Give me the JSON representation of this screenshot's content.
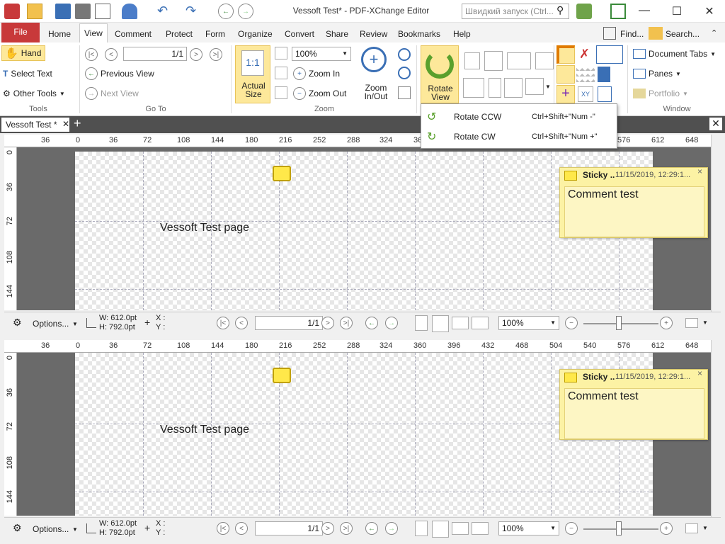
{
  "window": {
    "title": "Vessoft Test* - PDF-XChange Editor",
    "quick_launch_placeholder": "Швидкий запуск (Ctrl..."
  },
  "ribbon_tabs": [
    "File",
    "Home",
    "View",
    "Comment",
    "Protect",
    "Form",
    "Organize",
    "Convert",
    "Share",
    "Review",
    "Bookmarks",
    "Help"
  ],
  "ribbon_right": {
    "find": "Find...",
    "search": "Search..."
  },
  "tools": {
    "hand": "Hand",
    "select_text": "Select Text",
    "other_tools": "Other Tools",
    "label": "Tools"
  },
  "goto": {
    "page_value": "1/1",
    "previous_view": "Previous View",
    "next_view": "Next View",
    "label": "Go To"
  },
  "zoom": {
    "actual_size": "Actual\nSize",
    "actual_icon": "1:1",
    "zoom_value": "100%",
    "zoom_in": "Zoom In",
    "zoom_out": "Zoom Out",
    "zoom_inout": "Zoom\nIn/Out",
    "label": "Zoom"
  },
  "rotate": {
    "label": "Rotate\nView"
  },
  "window_grp": {
    "document_tabs": "Document Tabs",
    "panes": "Panes",
    "portfolio": "Portfolio",
    "label": "Window"
  },
  "dropdown": {
    "items": [
      {
        "label": "Rotate CCW",
        "shortcut": "Ctrl+Shift+\"Num -\""
      },
      {
        "label": "Rotate CW",
        "shortcut": "Ctrl+Shift+\"Num +\""
      }
    ]
  },
  "doc_tab": {
    "label": "Vessoft Test *"
  },
  "ruler": {
    "h_ticks": [
      "36",
      "0",
      "36",
      "72",
      "108",
      "144",
      "180",
      "216",
      "252",
      "288",
      "324",
      "360",
      "396",
      "432",
      "468",
      "504",
      "540",
      "576",
      "612",
      "648"
    ],
    "v_ticks": [
      "0",
      "36",
      "72",
      "108",
      "144"
    ]
  },
  "page": {
    "text": "Vessoft Test page"
  },
  "sticky": {
    "title": "Sticky ..",
    "date": "11/15/2019, 12:29:1...",
    "body": "Comment test"
  },
  "statusbar": {
    "options": "Options...",
    "width": "W: 612.0pt",
    "height": "H: 792.0pt",
    "x": "X :",
    "y": "Y :",
    "page": "1/1",
    "zoom": "100%"
  }
}
